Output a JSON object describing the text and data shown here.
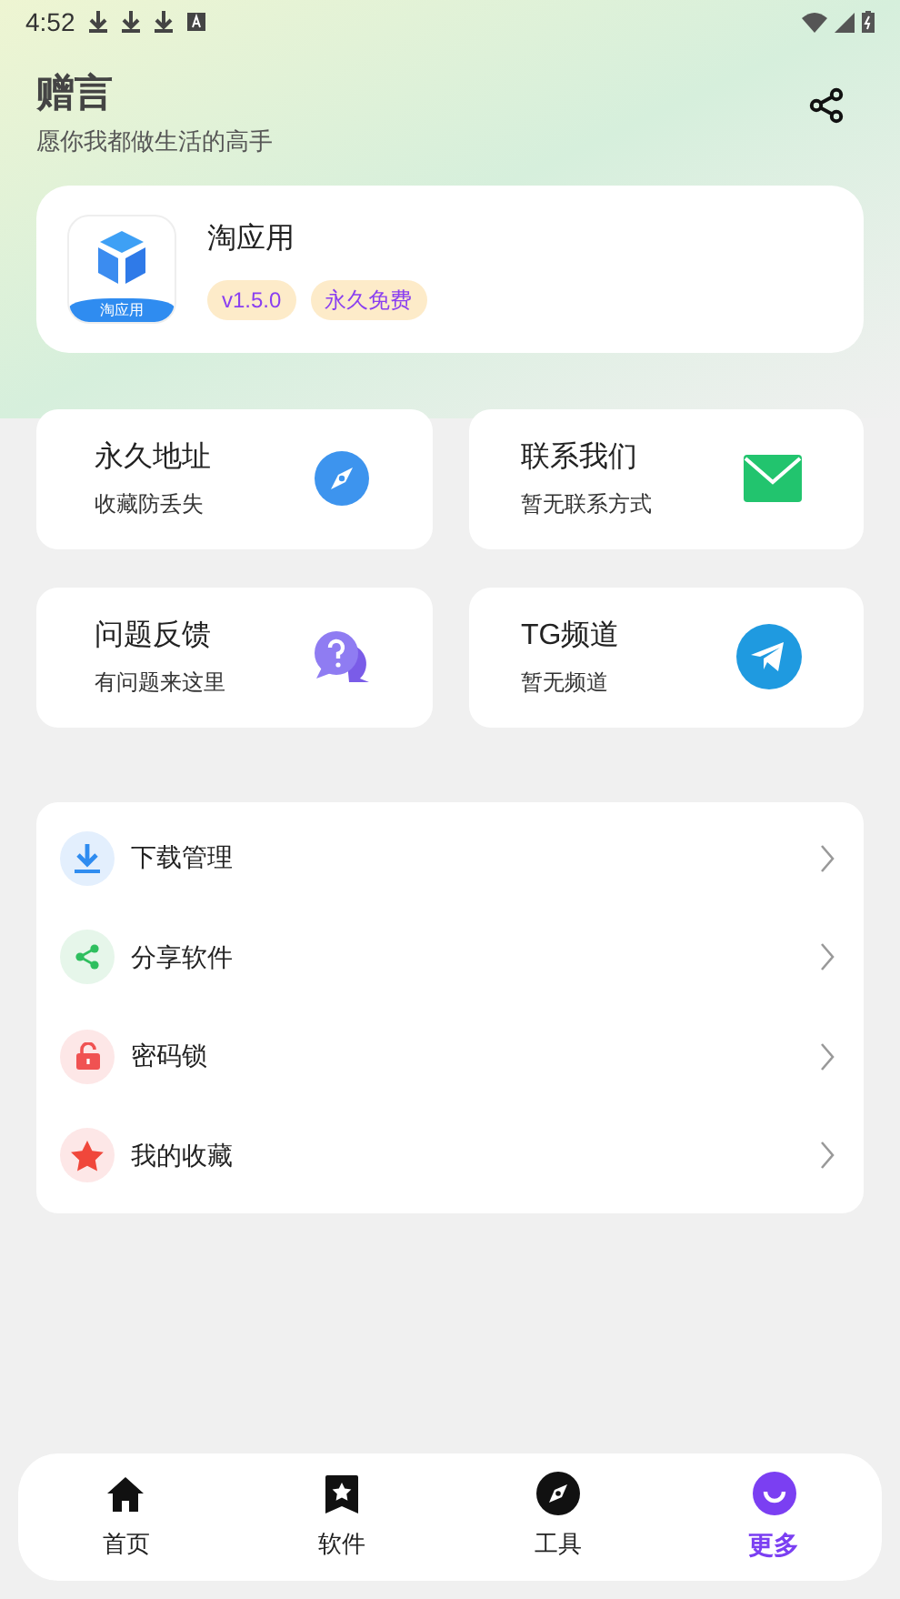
{
  "status_bar": {
    "time": "4:52"
  },
  "header": {
    "title": "赠言",
    "subtitle": "愿你我都做生活的高手"
  },
  "app": {
    "name": "淘应用",
    "icon_label": "淘应用",
    "tags": [
      "v1.5.0",
      "永久免费"
    ]
  },
  "tiles": [
    {
      "kind": "compass",
      "title": "永久地址",
      "subtitle": "收藏防丢失"
    },
    {
      "kind": "mail",
      "title": "联系我们",
      "subtitle": "暂无联系方式"
    },
    {
      "kind": "question",
      "title": "问题反馈",
      "subtitle": "有问题来这里"
    },
    {
      "kind": "telegram",
      "title": "TG频道",
      "subtitle": "暂无频道"
    }
  ],
  "menu": [
    {
      "kind": "download",
      "label": "下载管理"
    },
    {
      "kind": "share",
      "label": "分享软件"
    },
    {
      "kind": "lock",
      "label": "密码锁"
    },
    {
      "kind": "star",
      "label": "我的收藏"
    }
  ],
  "nav": [
    {
      "kind": "home",
      "label": "首页",
      "selected": false
    },
    {
      "kind": "bookmark",
      "label": "软件",
      "selected": false
    },
    {
      "kind": "compass",
      "label": "工具",
      "selected": false
    },
    {
      "kind": "smile",
      "label": "更多",
      "selected": true
    }
  ]
}
